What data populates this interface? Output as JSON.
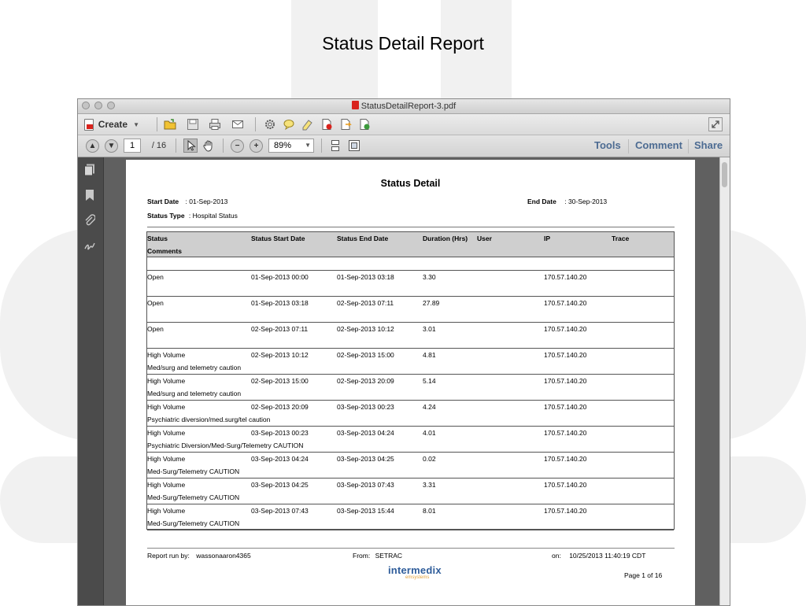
{
  "slide": {
    "title": "Status Detail Report"
  },
  "window": {
    "title": "StatusDetailReport-3.pdf"
  },
  "toolbar": {
    "create_label": "Create",
    "page_current": "1",
    "page_total": "/ 16",
    "zoom": "89%",
    "tools_label": "Tools",
    "comment_label": "Comment",
    "share_label": "Share"
  },
  "report": {
    "title": "Status Detail",
    "start_date_label": "Start Date",
    "start_date_value": ": 01-Sep-2013",
    "end_date_label": "End Date",
    "end_date_value": ": 30-Sep-2013",
    "status_type_label": "Status Type",
    "status_type_value": ": Hospital Status",
    "columns": {
      "status": "Status",
      "start": "Status Start Date",
      "end": "Status End Date",
      "duration": "Duration (Hrs)",
      "user": "User",
      "ip": "IP",
      "trace": "Trace",
      "comments": "Comments"
    },
    "rows": [
      {
        "status": "Open",
        "start": "01-Sep-2013 00:00",
        "end": "01-Sep-2013 03:18",
        "duration": "3.30",
        "ip": "170.57.140.20",
        "comment": ""
      },
      {
        "status": "Open",
        "start": "01-Sep-2013 03:18",
        "end": "02-Sep-2013 07:11",
        "duration": "27.89",
        "ip": "170.57.140.20",
        "comment": ""
      },
      {
        "status": "Open",
        "start": "02-Sep-2013 07:11",
        "end": "02-Sep-2013 10:12",
        "duration": "3.01",
        "ip": "170.57.140.20",
        "comment": ""
      },
      {
        "status": "High Volume",
        "start": "02-Sep-2013 10:12",
        "end": "02-Sep-2013 15:00",
        "duration": "4.81",
        "ip": "170.57.140.20",
        "comment": "Med/surg and telemetry caution"
      },
      {
        "status": "High Volume",
        "start": "02-Sep-2013 15:00",
        "end": "02-Sep-2013 20:09",
        "duration": "5.14",
        "ip": "170.57.140.20",
        "comment": "Med/surg and telemetry caution"
      },
      {
        "status": "High Volume",
        "start": "02-Sep-2013 20:09",
        "end": "03-Sep-2013 00:23",
        "duration": "4.24",
        "ip": "170.57.140.20",
        "comment": "Psychiatric diversion/med.surg/tel caution"
      },
      {
        "status": "High Volume",
        "start": "03-Sep-2013 00:23",
        "end": "03-Sep-2013 04:24",
        "duration": "4.01",
        "ip": "170.57.140.20",
        "comment": "Psychiatric Diversion/Med-Surg/Telemetry CAUTION"
      },
      {
        "status": "High Volume",
        "start": "03-Sep-2013 04:24",
        "end": "03-Sep-2013 04:25",
        "duration": "0.02",
        "ip": "170.57.140.20",
        "comment": "Med-Surg/Telemetry CAUTION"
      },
      {
        "status": "High Volume",
        "start": "03-Sep-2013 04:25",
        "end": "03-Sep-2013 07:43",
        "duration": "3.31",
        "ip": "170.57.140.20",
        "comment": "Med-Surg/Telemetry CAUTION"
      },
      {
        "status": "High Volume",
        "start": "03-Sep-2013 07:43",
        "end": "03-Sep-2013 15:44",
        "duration": "8.01",
        "ip": "170.57.140.20",
        "comment": "Med-Surg/Telemetry CAUTION"
      }
    ],
    "footer": {
      "run_by_label": "Report run by:",
      "run_by_value": "wassonaaron4365",
      "from_label": "From:",
      "from_value": "SETRAC",
      "on_label": "on:",
      "on_value": "10/25/2013 11:40:19 CDT",
      "logo_main": "intermedix",
      "logo_sub": "emsystems",
      "page": "Page 1 of 16"
    }
  }
}
